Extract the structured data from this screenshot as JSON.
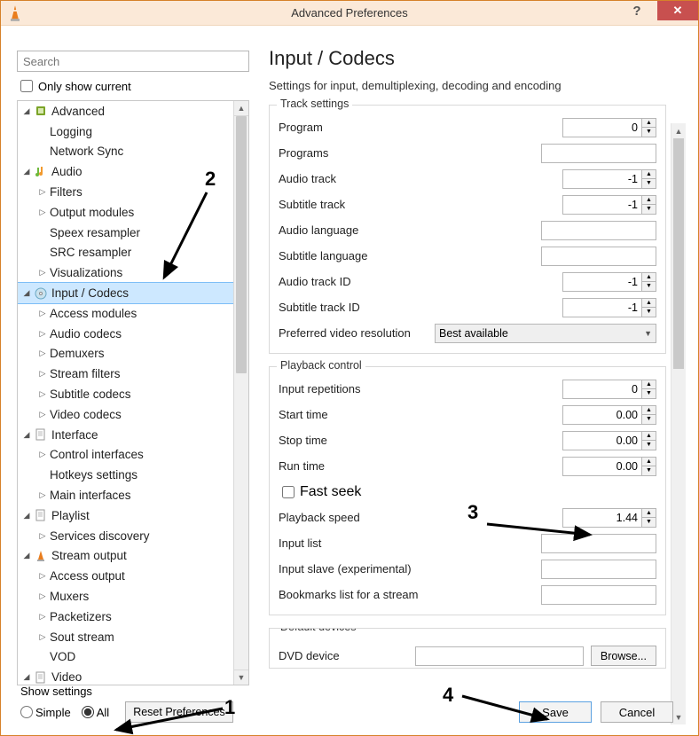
{
  "window": {
    "title": "Advanced Preferences"
  },
  "search": {
    "placeholder": "Search"
  },
  "only_show": "Only show current",
  "tree": {
    "items": [
      {
        "ind": 1,
        "tw": "d",
        "icon": "chip",
        "label": "Advanced"
      },
      {
        "ind": 2,
        "tw": "",
        "icon": "",
        "label": "Logging"
      },
      {
        "ind": 2,
        "tw": "",
        "icon": "",
        "label": "Network Sync"
      },
      {
        "ind": 1,
        "tw": "d",
        "icon": "note",
        "label": "Audio"
      },
      {
        "ind": 2,
        "tw": "r",
        "icon": "",
        "label": "Filters"
      },
      {
        "ind": 2,
        "tw": "r",
        "icon": "",
        "label": "Output modules"
      },
      {
        "ind": 2,
        "tw": "",
        "icon": "",
        "label": "Speex resampler"
      },
      {
        "ind": 2,
        "tw": "",
        "icon": "",
        "label": "SRC resampler"
      },
      {
        "ind": 2,
        "tw": "r",
        "icon": "",
        "label": "Visualizations"
      },
      {
        "ind": 1,
        "tw": "d",
        "icon": "disc",
        "label": "Input / Codecs",
        "selected": true
      },
      {
        "ind": 2,
        "tw": "r",
        "icon": "",
        "label": "Access modules"
      },
      {
        "ind": 2,
        "tw": "r",
        "icon": "",
        "label": "Audio codecs"
      },
      {
        "ind": 2,
        "tw": "r",
        "icon": "",
        "label": "Demuxers"
      },
      {
        "ind": 2,
        "tw": "r",
        "icon": "",
        "label": "Stream filters"
      },
      {
        "ind": 2,
        "tw": "r",
        "icon": "",
        "label": "Subtitle codecs"
      },
      {
        "ind": 2,
        "tw": "r",
        "icon": "",
        "label": "Video codecs"
      },
      {
        "ind": 1,
        "tw": "d",
        "icon": "doc",
        "label": "Interface"
      },
      {
        "ind": 2,
        "tw": "r",
        "icon": "",
        "label": "Control interfaces"
      },
      {
        "ind": 2,
        "tw": "",
        "icon": "",
        "label": "Hotkeys settings"
      },
      {
        "ind": 2,
        "tw": "r",
        "icon": "",
        "label": "Main interfaces"
      },
      {
        "ind": 1,
        "tw": "d",
        "icon": "doc",
        "label": "Playlist"
      },
      {
        "ind": 2,
        "tw": "r",
        "icon": "",
        "label": "Services discovery"
      },
      {
        "ind": 1,
        "tw": "dr",
        "icon": "cone",
        "label": "Stream output"
      },
      {
        "ind": 2,
        "tw": "r",
        "icon": "",
        "label": "Access output"
      },
      {
        "ind": 2,
        "tw": "r",
        "icon": "",
        "label": "Muxers"
      },
      {
        "ind": 2,
        "tw": "r",
        "icon": "",
        "label": "Packetizers"
      },
      {
        "ind": 2,
        "tw": "r",
        "icon": "",
        "label": "Sout stream"
      },
      {
        "ind": 2,
        "tw": "",
        "icon": "",
        "label": "VOD"
      },
      {
        "ind": 1,
        "tw": "d",
        "icon": "doc",
        "label": "Video"
      }
    ]
  },
  "show_settings": {
    "title": "Show settings",
    "simple": "Simple",
    "all": "All",
    "selected": "All",
    "reset": "Reset Preferences"
  },
  "right": {
    "title": "Input / Codecs",
    "subtitle": "Settings for input, demultiplexing, decoding and encoding",
    "group1_title": "Track settings",
    "program_lbl": "Program",
    "program_val": "0",
    "programs_lbl": "Programs",
    "programs_val": "",
    "audio_track_lbl": "Audio track",
    "audio_track_val": "-1",
    "sub_track_lbl": "Subtitle track",
    "sub_track_val": "-1",
    "audio_lang_lbl": "Audio language",
    "audio_lang_val": "",
    "sub_lang_lbl": "Subtitle language",
    "sub_lang_val": "",
    "audio_id_lbl": "Audio track ID",
    "audio_id_val": "-1",
    "sub_id_lbl": "Subtitle track ID",
    "sub_id_val": "-1",
    "pref_res_lbl": "Preferred video resolution",
    "pref_res_val": "Best available",
    "group2_title": "Playback control",
    "reps_lbl": "Input repetitions",
    "reps_val": "0",
    "start_lbl": "Start time",
    "start_val": "0.00",
    "stop_lbl": "Stop time",
    "stop_val": "0.00",
    "run_lbl": "Run time",
    "run_val": "0.00",
    "fast_lbl": "Fast seek",
    "speed_lbl": "Playback speed",
    "speed_val": "1.44",
    "inlist_lbl": "Input list",
    "inlist_val": "",
    "inslave_lbl": "Input slave (experimental)",
    "inslave_val": "",
    "bmk_lbl": "Bookmarks list for a stream",
    "bmk_val": "",
    "group3_title": "Default devices",
    "dvd_lbl": "DVD device",
    "dvd_val": "",
    "browse": "Browse..."
  },
  "buttons": {
    "save": "Save",
    "cancel": "Cancel"
  },
  "annotations": {
    "n1": "1",
    "n2": "2",
    "n3": "3",
    "n4": "4"
  }
}
